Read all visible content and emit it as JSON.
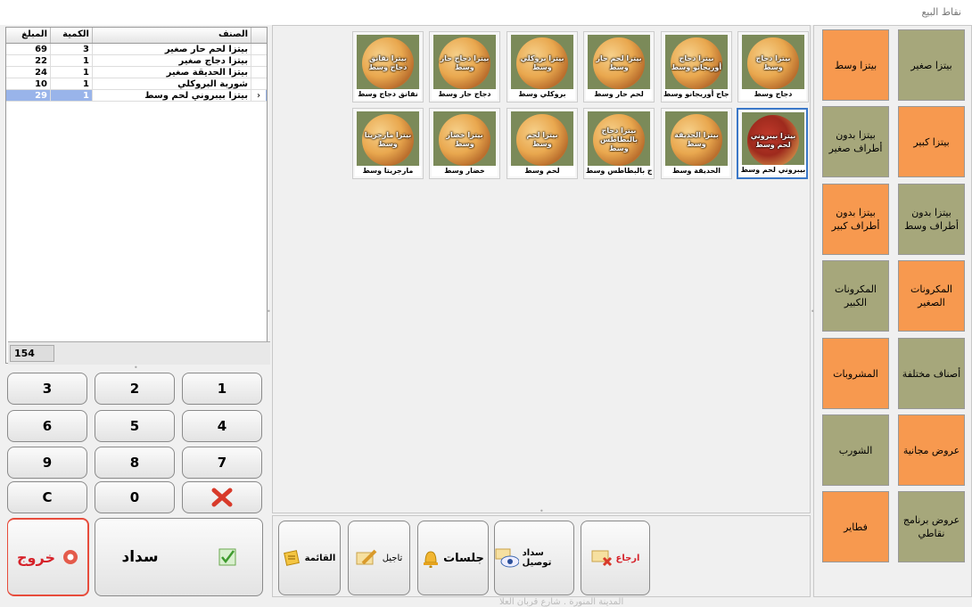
{
  "window": {
    "title": "نقاط البيع"
  },
  "order_grid": {
    "columns": {
      "amount": "المبلغ",
      "qty": "الكمية",
      "name": "الصنف"
    },
    "rows": [
      {
        "amount": "69",
        "qty": "3",
        "name": "بيتزا لحم حار صغير"
      },
      {
        "amount": "22",
        "qty": "1",
        "name": "بيتزا دجاج صغير"
      },
      {
        "amount": "24",
        "qty": "1",
        "name": "بيتزا الحديقة صغير"
      },
      {
        "amount": "10",
        "qty": "1",
        "name": "شوربة البروكلي"
      },
      {
        "amount": "29",
        "qty": "1",
        "name": "بيتزا بيبروني لحم وسط",
        "selected": true,
        "indicator": "›"
      }
    ],
    "total": "154"
  },
  "keypad": {
    "k3": "3",
    "k2": "2",
    "k1": "1",
    "k6": "6",
    "k5": "5",
    "k4": "4",
    "k9": "9",
    "k8": "8",
    "k7": "7",
    "kc": "C",
    "k0": "0"
  },
  "actions": {
    "exit": "خروج",
    "pay": "سداد",
    "list": "القائمة",
    "postpone": "تاجيل",
    "sessions": "جلسات",
    "delivery_pay": "سداد توصيل",
    "return": "ارجاع"
  },
  "products": [
    {
      "img_text": "بيتزا دجاج وسط",
      "label": "دجاج وسط"
    },
    {
      "img_text": "بيتزا دجاج أوريجانو وسط",
      "label": "دجاج أوريجانو وسط"
    },
    {
      "img_text": "بيتزا لحم حار وسط",
      "label": "لحم حار وسط"
    },
    {
      "img_text": "بيتزا بروكلي وسط",
      "label": "بروكلي وسط"
    },
    {
      "img_text": "بيتزا دجاج حار وسط",
      "label": "دجاج حار وسط"
    },
    {
      "img_text": "بيتزا نقانق دجاج وسط",
      "label": "نقانق دجاج وسط"
    },
    {
      "img_text": "بيتزا بيبروني لحم وسط",
      "label": "بيبروني لحم وسط",
      "selected": true
    },
    {
      "img_text": "بيتزا الحديقة وسط",
      "label": "الحديقة وسط"
    },
    {
      "img_text": "بيتزا دجاج بالبطاطس وسط",
      "label": "دجاج بالبطاطس وسط"
    },
    {
      "img_text": "بيتزا لحم وسط",
      "label": "لحم وسط"
    },
    {
      "img_text": "بيتزا خضار وسط",
      "label": "خضار وسط"
    },
    {
      "img_text": "بيتزا مارجريتا وسط",
      "label": "مارجريتا وسط"
    }
  ],
  "categories": [
    {
      "label": "بيتزا صغير",
      "color": "olive"
    },
    {
      "label": "بيتزا وسط",
      "color": "orange"
    },
    {
      "label": "بيتزا كبير",
      "color": "orange"
    },
    {
      "label": "بيتزا بدون أطراف صغير",
      "color": "olive"
    },
    {
      "label": "بيتزا بدون أطراف وسط",
      "color": "olive"
    },
    {
      "label": "بيتزا بدون أطراف كبير",
      "color": "orange"
    },
    {
      "label": "المكرونات الصغير",
      "color": "orange"
    },
    {
      "label": "المكرونات الكبير",
      "color": "olive"
    },
    {
      "label": "أصناف مختلفة",
      "color": "olive"
    },
    {
      "label": "المشروبات",
      "color": "orange"
    },
    {
      "label": "عروض مجانية",
      "color": "orange"
    },
    {
      "label": "الشورب",
      "color": "olive"
    },
    {
      "label": "عروض برنامج نقاطي",
      "color": "olive"
    },
    {
      "label": "فطاير",
      "color": "orange"
    }
  ],
  "footer_text": "المدينة المنورة . شارع قربان العلا"
}
